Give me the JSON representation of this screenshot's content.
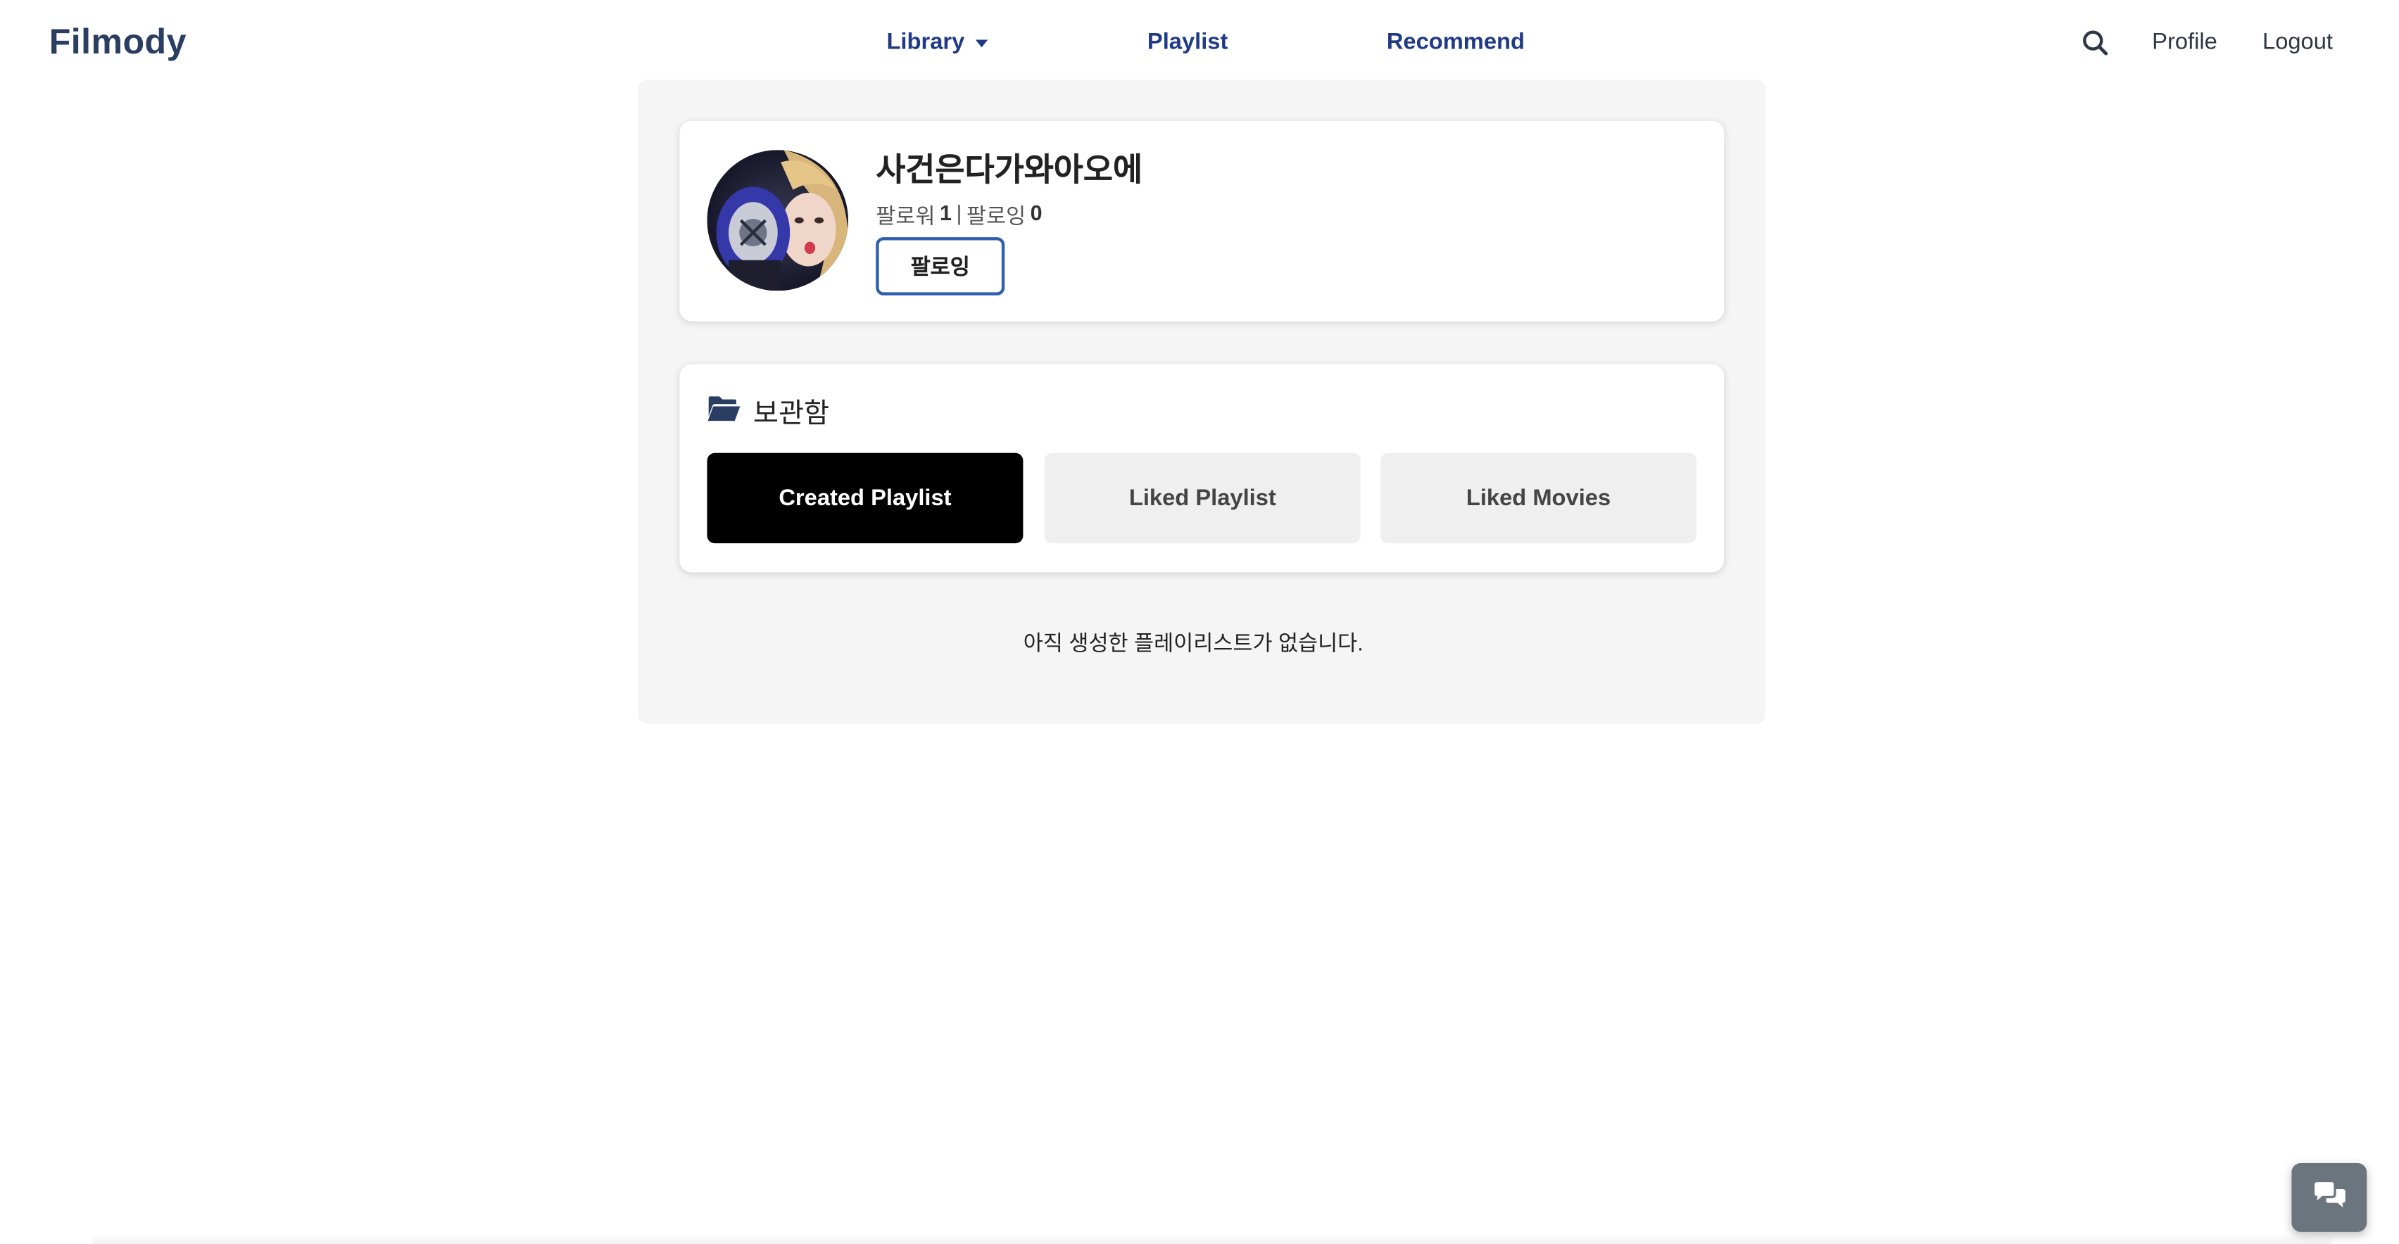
{
  "navbar": {
    "brand": "Filmody",
    "links": {
      "library": "Library",
      "playlist": "Playlist",
      "recommend": "Recommend"
    },
    "search_icon": "search-icon",
    "profile": "Profile",
    "logout": "Logout",
    "link_color": "#213a86"
  },
  "profile": {
    "username": "사건은다가와아오에",
    "followers_label": "팔로워",
    "followers_count": "1",
    "separator": "|",
    "following_label": "팔로잉",
    "following_count": "0",
    "follow_button": "팔로잉"
  },
  "storage": {
    "icon": "folder-open-icon",
    "title": "보관함",
    "tabs": {
      "created_playlist": "Created Playlist",
      "liked_playlist": "Liked Playlist",
      "liked_movies": "Liked Movies"
    },
    "active_tab": "Created Playlist"
  },
  "empty_message": "아직 생성한 플레이리스트가 없습니다.",
  "chat_icon": "chat-bubbles-icon"
}
